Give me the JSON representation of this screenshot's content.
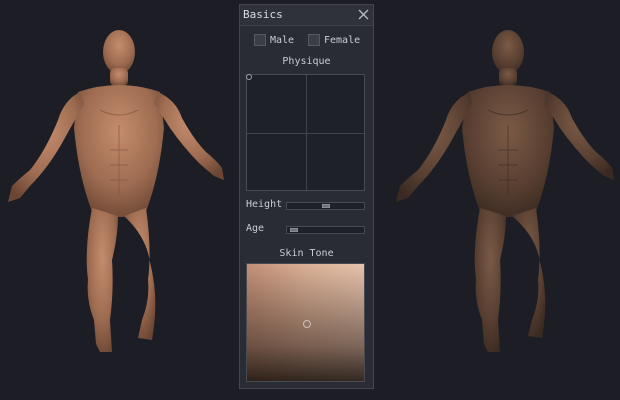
{
  "panel": {
    "title": "Basics",
    "gender": [
      {
        "label": "Male",
        "checked": false
      },
      {
        "label": "Female",
        "checked": false
      }
    ],
    "physique_title": "Physique",
    "sliders": [
      {
        "label": "Height",
        "value": 0.5
      },
      {
        "label": "Age",
        "value": 0.05
      }
    ],
    "skin_tone_title": "Skin Tone"
  },
  "colors": {
    "background": "#1d1e25",
    "panel": "#2a2c33",
    "light_skin": "#b78163",
    "dark_skin": "#5e4332"
  },
  "icons": {
    "close": "close-icon"
  }
}
